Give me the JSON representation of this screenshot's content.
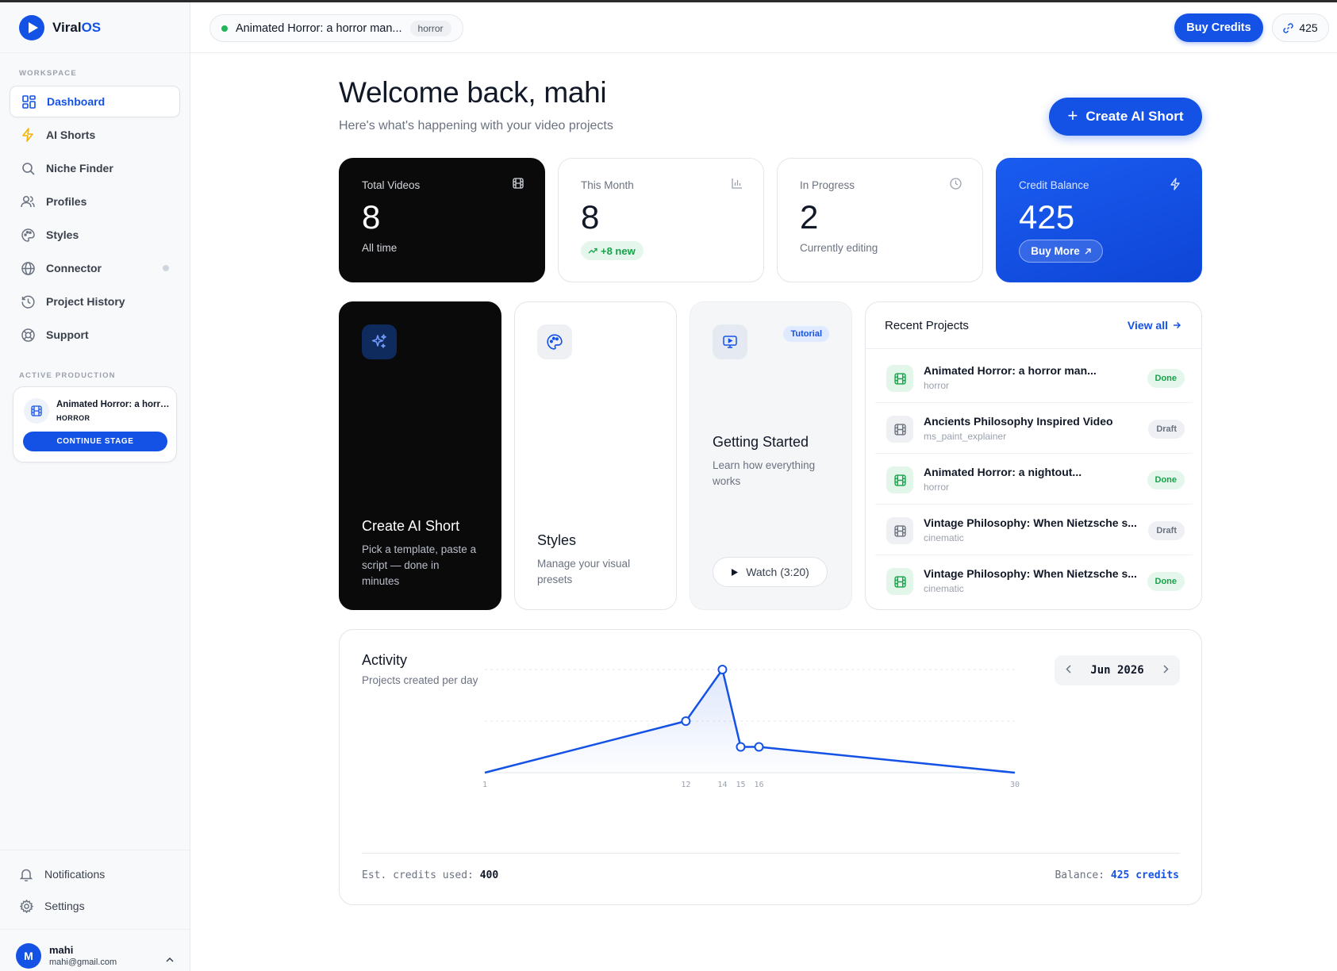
{
  "brand": {
    "name_main": "Viral",
    "name_accent": "OS"
  },
  "sidebar": {
    "workspace_label": "WORKSPACE",
    "items": [
      {
        "label": "Dashboard",
        "icon": "grid-icon"
      },
      {
        "label": "AI Shorts",
        "icon": "bolt-icon"
      },
      {
        "label": "Niche Finder",
        "icon": "search-icon"
      },
      {
        "label": "Profiles",
        "icon": "users-icon"
      },
      {
        "label": "Styles",
        "icon": "palette-icon"
      },
      {
        "label": "Connector",
        "icon": "globe-icon"
      },
      {
        "label": "Project History",
        "icon": "history-icon"
      },
      {
        "label": "Support",
        "icon": "lifebuoy-icon"
      }
    ],
    "active_production_label": "ACTIVE PRODUCTION",
    "active_production": {
      "title": "Animated Horror: a horror man...",
      "tag": "HORROR",
      "button": "CONTINUE STAGE"
    },
    "bottom_items": [
      {
        "label": "Notifications",
        "icon": "bell-icon"
      },
      {
        "label": "Settings",
        "icon": "gear-icon"
      }
    ],
    "user": {
      "initial": "M",
      "name": "mahi",
      "email": "mahi@gmail.com"
    }
  },
  "header": {
    "project_title": "Animated Horror: a horror man...",
    "project_tag": "horror",
    "buy_credits": "Buy Credits",
    "credits": "425"
  },
  "main": {
    "welcome": "Welcome back, mahi",
    "subtitle": "Here's what's happening with your video projects",
    "create_button": "Create AI Short",
    "stats": [
      {
        "label": "Total Videos",
        "value": "8",
        "sub": "All time"
      },
      {
        "label": "This Month",
        "value": "8",
        "badge": "+8 new"
      },
      {
        "label": "In Progress",
        "value": "2",
        "sub": "Currently editing"
      },
      {
        "label": "Credit Balance",
        "value": "425",
        "button": "Buy More"
      }
    ],
    "tiles": [
      {
        "title": "Create AI Short",
        "desc_lines": [
          "Pick a template, paste a",
          "script — done in",
          "minutes"
        ]
      },
      {
        "title": "Styles",
        "desc_lines": [
          "Manage your visual",
          "presets"
        ]
      },
      {
        "title": "Getting Started",
        "badge": "Tutorial",
        "desc_lines": [
          "Learn how everything",
          "works"
        ],
        "button": "Watch (3:20)"
      }
    ],
    "recent": {
      "title": "Recent Projects",
      "view_all": "View all",
      "rows": [
        {
          "title": "Animated Horror: a horror man...",
          "sub": "horror",
          "status": "Done"
        },
        {
          "title": "Ancients Philosophy Inspired Video",
          "sub": "ms_paint_explainer",
          "status": "Draft"
        },
        {
          "title": "Animated Horror: a nightout...",
          "sub": "horror",
          "status": "Done"
        },
        {
          "title": "Vintage Philosophy: When Nietzsche s...",
          "sub": "cinematic",
          "status": "Draft"
        },
        {
          "title": "Vintage Philosophy: When Nietzsche s...",
          "sub": "cinematic",
          "status": "Done"
        }
      ]
    },
    "activity": {
      "title": "Activity",
      "subtitle": "Projects created per day",
      "month": "Jun 2026",
      "footer_left_label": "Est. credits used:",
      "footer_left_value": "400",
      "footer_right_label": "Balance:",
      "footer_right_value": "425 credits"
    }
  },
  "colors": {
    "accent": "#1452e6",
    "success": "#16a34a",
    "dark": "#0a0a0a"
  },
  "chart_data": {
    "type": "area",
    "title": "Activity",
    "subtitle": "Projects created per day",
    "x_tick_labels": [
      "1",
      "12",
      "14",
      "15",
      "16",
      "30"
    ],
    "x": [
      1,
      12,
      14,
      15,
      16,
      30
    ],
    "values": [
      0,
      1,
      2,
      0.5,
      0.5,
      0
    ],
    "xlim": [
      1,
      30
    ],
    "ylim": [
      0,
      2
    ],
    "grid": true,
    "color": "#1452e6"
  }
}
